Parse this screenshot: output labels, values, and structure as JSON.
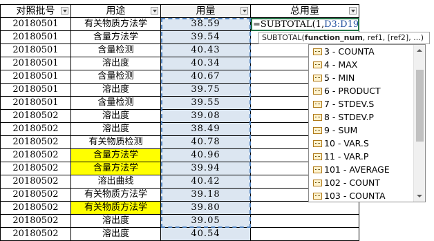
{
  "columns": [
    "对照批号",
    "用途",
    "用量",
    "总用量"
  ],
  "rows": [
    {
      "batch": "20180501",
      "use": "有关物质方法学",
      "amount": "38.59",
      "highlight": false
    },
    {
      "batch": "20180501",
      "use": "含量方法学",
      "amount": "39.54",
      "highlight": false
    },
    {
      "batch": "20180501",
      "use": "含量检测",
      "amount": "40.43",
      "highlight": false
    },
    {
      "batch": "20180501",
      "use": "溶出度",
      "amount": "40.34",
      "highlight": false
    },
    {
      "batch": "20180501",
      "use": "含量检测",
      "amount": "40.67",
      "highlight": false
    },
    {
      "batch": "20180501",
      "use": "溶出度",
      "amount": "39.75",
      "highlight": false
    },
    {
      "batch": "20180501",
      "use": "含量检测",
      "amount": "39.55",
      "highlight": false
    },
    {
      "batch": "20180502",
      "use": "溶出度",
      "amount": "39.08",
      "highlight": false
    },
    {
      "batch": "20180502",
      "use": "溶出度",
      "amount": "38.49",
      "highlight": false
    },
    {
      "batch": "20180502",
      "use": "有关物质检测",
      "amount": "40.78",
      "highlight": false
    },
    {
      "batch": "20180502",
      "use": "含量方法学",
      "amount": "40.96",
      "highlight": true
    },
    {
      "batch": "20180502",
      "use": "含量方法学",
      "amount": "39.94",
      "highlight": true
    },
    {
      "batch": "20180502",
      "use": "溶出曲线",
      "amount": "40.42",
      "highlight": false
    },
    {
      "batch": "20180502",
      "use": "有关物质方法学",
      "amount": "39.18",
      "highlight": false
    },
    {
      "batch": "20180502",
      "use": "有关物质方法学",
      "amount": "39.80",
      "highlight": true
    },
    {
      "batch": "20180502",
      "use": "溶出度",
      "amount": "39.05",
      "highlight": false
    },
    {
      "batch": "20180502",
      "use": "溶出度",
      "amount": "40.54",
      "highlight": false
    }
  ],
  "formula": {
    "prefix": "=SUBTOTAL(1,",
    "ref": "D3:D19",
    "suffix": ")"
  },
  "tooltip": {
    "name": "SUBTOTAL(",
    "current_arg": "function_num",
    "rest": ", ref1, [ref2], ...)"
  },
  "function_list": [
    "3 - COUNTA",
    "4 - MAX",
    "5 - MIN",
    "6 - PRODUCT",
    "7 - STDEV.S",
    "8 - STDEV.P",
    "9 - SUM",
    "10 - VAR.S",
    "11 - VAR.P",
    "101 - AVERAGE",
    "102 - COUNT",
    "103 - COUNTA"
  ],
  "colors": {
    "highlight": "#ffff00",
    "selection": "#dce6f1",
    "active_border": "#217346",
    "ref": "#1f4e9e"
  }
}
